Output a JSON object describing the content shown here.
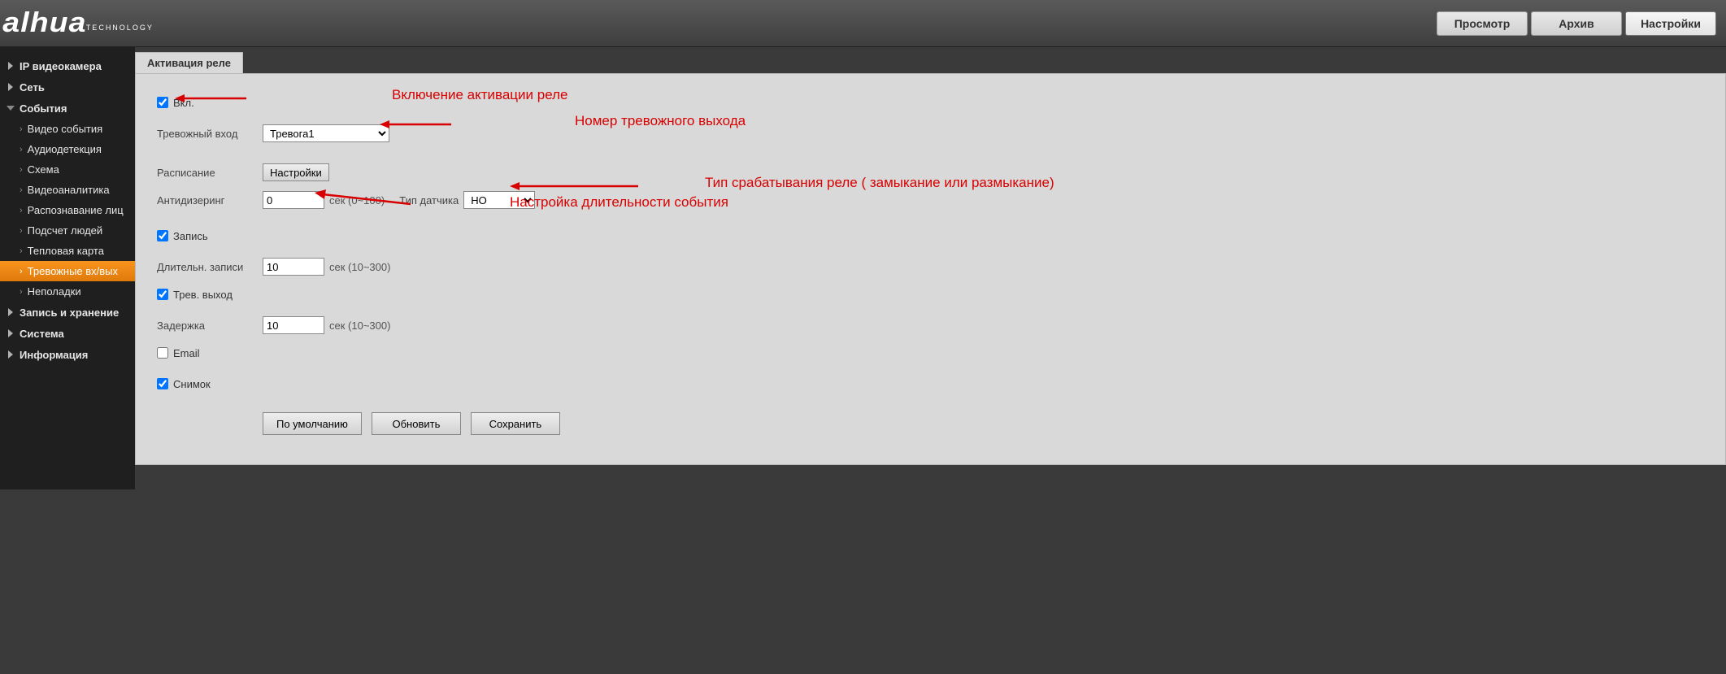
{
  "logo": {
    "main": "alhua",
    "sub": "TECHNOLOGY"
  },
  "topnav": {
    "preview": "Просмотр",
    "archive": "Архив",
    "settings": "Настройки"
  },
  "sidebar": {
    "ip_camera": "IP видеокамера",
    "network": "Сеть",
    "events": "События",
    "events_children": {
      "video_events": "Видео события",
      "audio_detect": "Аудиодетекция",
      "scheme": "Схема",
      "video_analytics": "Видеоаналитика",
      "face": "Распознавание лиц",
      "people_count": "Подсчет людей",
      "heatmap": "Тепловая карта",
      "alarm_io": "Тревожные вх/вых",
      "faults": "Неполадки"
    },
    "storage": "Запись и хранение",
    "system": "Система",
    "info": "Информация"
  },
  "tab": {
    "relay_act": "Активация реле"
  },
  "form": {
    "enable": "Вкл.",
    "alarm_in_label": "Тревожный вход",
    "alarm_in_value": "Тревога1",
    "schedule_label": "Расписание",
    "schedule_btn": "Настройки",
    "anti_dither_label": "Антидизеринг",
    "anti_dither_value": "0",
    "anti_dither_hint": "сек (0~100)",
    "sensor_type_label": "Тип датчика",
    "sensor_type_value": "НО",
    "record": "Запись",
    "rec_len_label": "Длительн. записи",
    "rec_len_value": "10",
    "rec_len_hint": "сек (10~300)",
    "alarm_out": "Трев. выход",
    "delay_label": "Задержка",
    "delay_value": "10",
    "delay_hint": "сек (10~300)",
    "email": "Email",
    "snapshot": "Снимок",
    "btn_default": "По умолчанию",
    "btn_refresh": "Обновить",
    "btn_save": "Сохранить"
  },
  "annotations": {
    "enable": "Включение активации реле",
    "alarm_no": "Номер тревожного выхода",
    "sensor": "Тип срабатывания реле ( замыкание или размыкание)",
    "duration": "Настройка длительности события"
  }
}
